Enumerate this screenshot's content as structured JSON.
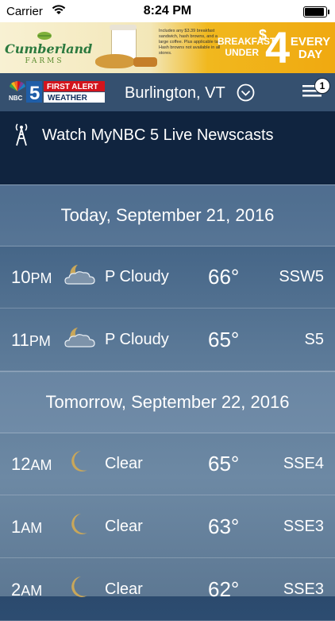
{
  "status_bar": {
    "carrier": "Carrier",
    "time": "8:24 PM",
    "battery_level": 1.0
  },
  "ad": {
    "brand_name": "Cumberland",
    "brand_sub": "FARMS",
    "fine_print": "Includes any $3.39 breakfast sandwich, hash browns, and a large coffee. Plus applicable tax. Hash browns not available in all stores.",
    "line1": "BREAKFAST",
    "line2": "UNDER",
    "dollar": "$",
    "price": "4",
    "every": "EVERY",
    "day": "DAY"
  },
  "header": {
    "station_number": "5",
    "station_network": "NBC",
    "first_alert": "FIRST ALERT",
    "weather": "WEATHER",
    "location": "Burlington, VT",
    "menu_badge": "1"
  },
  "live": {
    "label": "Watch MyNBC 5 Live Newscasts"
  },
  "forecast": {
    "days": [
      {
        "title": "Today, September 21, 2016",
        "hours": [
          {
            "hour": "10",
            "ampm": "PM",
            "icon": "moon-cloud-icon",
            "condition": "P Cloudy",
            "temp": "66°",
            "wind": "SSW5"
          },
          {
            "hour": "11",
            "ampm": "PM",
            "icon": "moon-cloud-icon",
            "condition": "P Cloudy",
            "temp": "65°",
            "wind": "S5"
          }
        ]
      },
      {
        "title": "Tomorrow, September 22, 2016",
        "hours": [
          {
            "hour": "12",
            "ampm": "AM",
            "icon": "moon-icon",
            "condition": "Clear",
            "temp": "65°",
            "wind": "SSE4"
          },
          {
            "hour": "1",
            "ampm": "AM",
            "icon": "moon-icon",
            "condition": "Clear",
            "temp": "63°",
            "wind": "SSE3"
          },
          {
            "hour": "2",
            "ampm": "AM",
            "icon": "moon-icon",
            "condition": "Clear",
            "temp": "62°",
            "wind": "SSE3"
          }
        ]
      }
    ]
  },
  "colors": {
    "moon": "#c9a75a",
    "header_bg": "#35506f",
    "live_bg": "#10243f",
    "nbc_red": "#d3141c"
  }
}
